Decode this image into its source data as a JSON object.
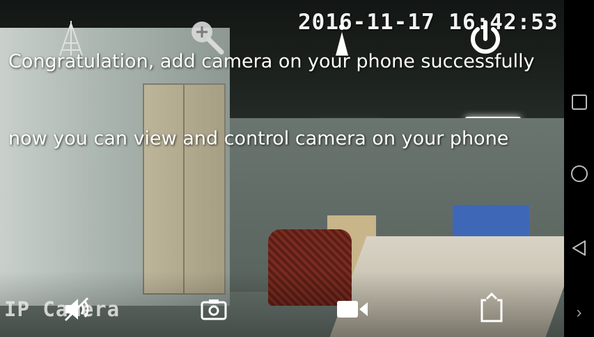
{
  "feed": {
    "timestamp": "2016-11-17 16:42:53",
    "message_line1": "Congratulation, add camera on your phone successfully",
    "message_line2": "now you can view and control camera  on your phone",
    "camera_name": "IP Camera"
  },
  "top_controls": {
    "icons": [
      "antenna-icon",
      "zoom-in-icon",
      "pointer-icon",
      "power-icon"
    ]
  },
  "bottom_controls": {
    "icons": [
      "speaker-mute-icon",
      "snapshot-icon",
      "record-icon",
      "share-icon"
    ]
  },
  "navbar": {
    "icons": [
      "recent-apps-icon",
      "home-icon",
      "back-icon",
      "more-icon"
    ],
    "more_label": "›"
  },
  "colors": {
    "overlay_text": "#ffffff",
    "icon_white": "#ffffff",
    "navbar_bg": "#000000"
  }
}
